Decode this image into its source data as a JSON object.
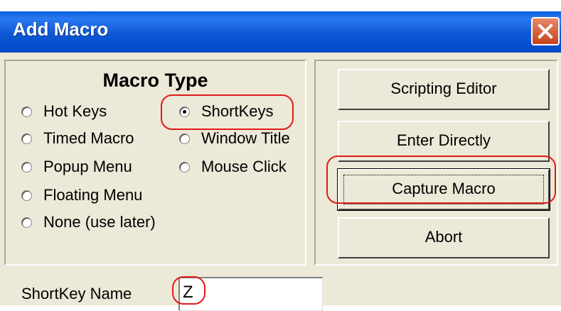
{
  "window": {
    "title": "Add Macro"
  },
  "macro_type": {
    "title": "Macro Type",
    "options": [
      {
        "label": "Hot Keys",
        "checked": false
      },
      {
        "label": "ShortKeys",
        "checked": true
      },
      {
        "label": "Timed Macro",
        "checked": false
      },
      {
        "label": "Window Title",
        "checked": false
      },
      {
        "label": "Popup Menu",
        "checked": false
      },
      {
        "label": "Mouse Click",
        "checked": false
      },
      {
        "label": "Floating Menu",
        "checked": false
      },
      {
        "label": "None (use later)",
        "checked": false
      }
    ]
  },
  "buttons": {
    "scripting_editor": "Scripting Editor",
    "enter_directly": "Enter Directly",
    "capture_macro": "Capture Macro",
    "abort": "Abort"
  },
  "shortkey": {
    "label": "ShortKey Name",
    "value": "Z"
  },
  "colors": {
    "titlebar": "#0a5fdc",
    "highlight": "#e01a1a",
    "dialog_bg": "#ece9d8"
  }
}
